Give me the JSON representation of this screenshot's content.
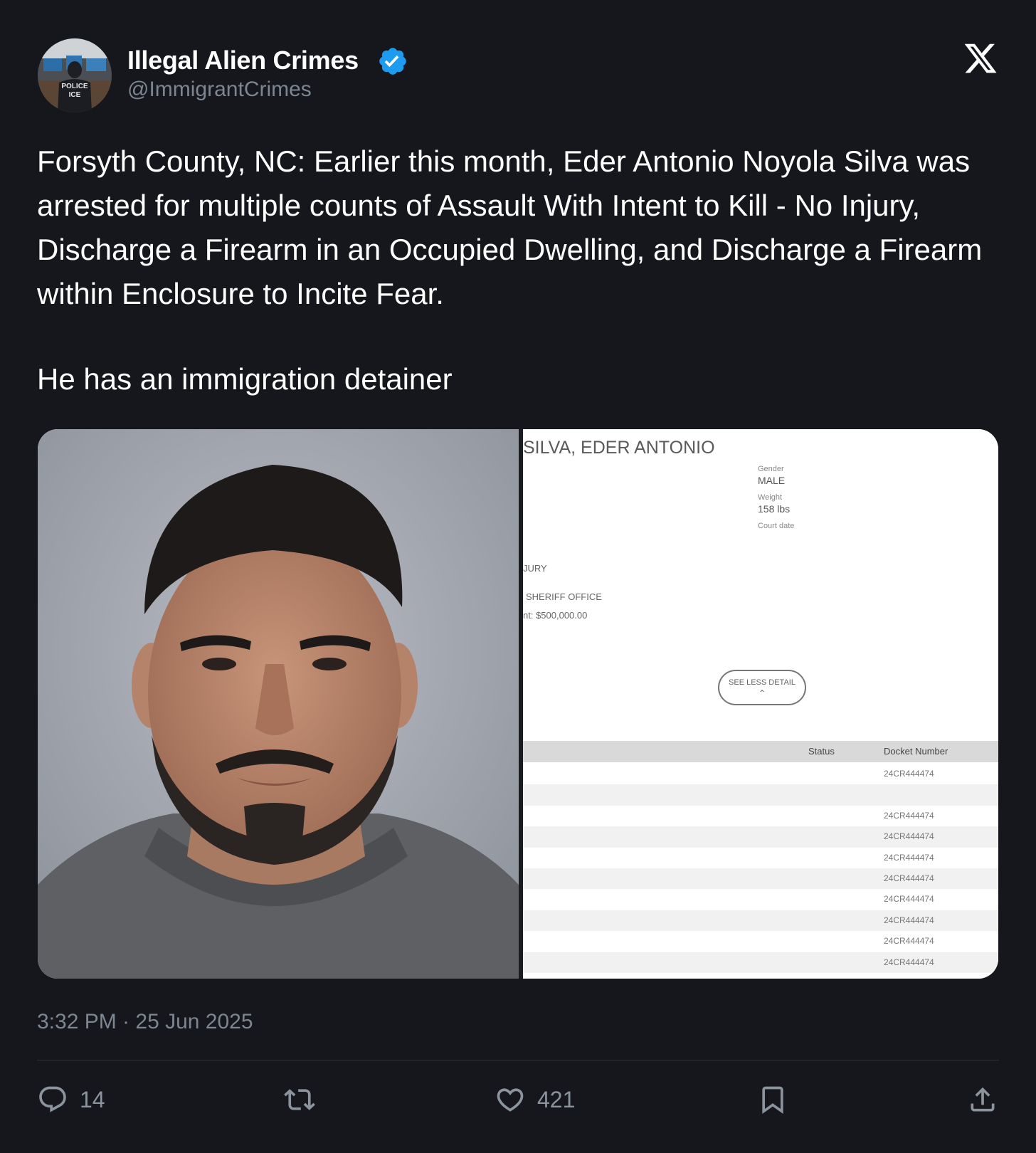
{
  "author": {
    "name": "Illegal Alien Crimes",
    "handle": "@ImmigrantCrimes",
    "avatar_text": [
      "POLICE",
      "ICE"
    ],
    "verified_color": "#1d9bf0"
  },
  "platform_icon": "x-logo-icon",
  "tweet": {
    "paragraphs": [
      "Forsyth County, NC: Earlier this month, Eder Antonio Noyola Silva was arrested for multiple counts of Assault With Intent to Kill - No Injury, Discharge a Firearm in an Occupied Dwelling, and Discharge a Firearm within Enclosure to Incite Fear.",
      "He has an immigration detainer"
    ]
  },
  "record": {
    "name": "SILVA, EDER ANTONIO",
    "gender_label": "Gender",
    "gender_value": "MALE",
    "weight_label": "Weight",
    "weight_value": "158 lbs",
    "court_label": "Court date",
    "fragment_injury": "JURY",
    "fragment_office": "SHERIFF OFFICE",
    "fragment_bond": "nt: $500,000.00",
    "see_less_label": "SEE LESS DETAIL",
    "see_less_icon": "chevron-up-icon",
    "col_status": "Status",
    "col_docket": "Docket Number",
    "rows": [
      "24CR444474",
      "",
      "24CR444474",
      "24CR444474",
      "24CR444474",
      "24CR444474",
      "24CR444474",
      "24CR444474",
      "24CR444474",
      "24CR444474"
    ]
  },
  "timestamp": "3:32 PM · 25 Jun 2025",
  "actions": {
    "reply_count": "14",
    "like_count": "421"
  },
  "colors": {
    "background": "#15171d",
    "muted_text": "#7c8690",
    "accent": "#1d9bf0"
  }
}
